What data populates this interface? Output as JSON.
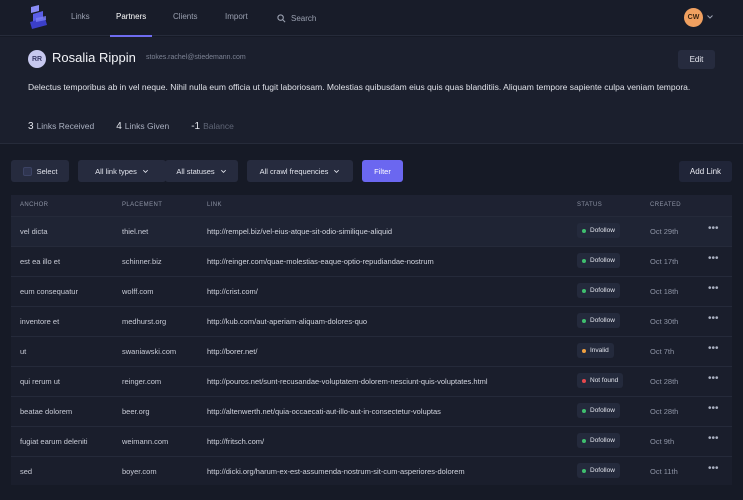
{
  "nav": {
    "items": [
      {
        "label": "Links"
      },
      {
        "label": "Partners"
      },
      {
        "label": "Clients"
      },
      {
        "label": "Import"
      }
    ],
    "search_label": "Search",
    "user_initials": "CW",
    "accent": "#6f6cf0"
  },
  "profile": {
    "initials": "RR",
    "name": "Rosalia Rippin",
    "email": "stokes.rachel@stiedemann.com",
    "edit_label": "Edit",
    "bio": "Delectus temporibus ab in vel neque. Nihil nulla eum officia ut fugit laboriosam. Molestias quibusdam eius quis quas blanditiis. Aliquam tempore sapiente culpa veniam tempora.",
    "stats": [
      {
        "value": "3",
        "label": "Links Received"
      },
      {
        "value": "4",
        "label": "Links Given"
      },
      {
        "value": "-1",
        "label": "Balance"
      }
    ]
  },
  "filters": {
    "select_label": "Select",
    "link_types": "All link types",
    "statuses": "All statuses",
    "crawl": "All crawl frequencies",
    "filter": "Filter",
    "add_link": "Add Link"
  },
  "table": {
    "headers": [
      "ANCHOR",
      "PLACEMENT",
      "LINK",
      "STATUS",
      "CREATED"
    ],
    "rows": [
      {
        "anchor": "vel dicta",
        "placement": "thiel.net",
        "link": "http://rempel.biz/vel-eius-atque-sit-odio-similique-aliquid",
        "status": "Dofollow",
        "status_color": "#3fbf6f",
        "created": "Oct 29th"
      },
      {
        "anchor": "est ea illo et",
        "placement": "schinner.biz",
        "link": "http://reinger.com/quae-molestias-eaque-optio-repudiandae-nostrum",
        "status": "Dofollow",
        "status_color": "#3fbf6f",
        "created": "Oct 17th"
      },
      {
        "anchor": "eum consequatur",
        "placement": "wolff.com",
        "link": "http://crist.com/",
        "status": "Dofollow",
        "status_color": "#3fbf6f",
        "created": "Oct 18th"
      },
      {
        "anchor": "inventore et",
        "placement": "medhurst.org",
        "link": "http://kub.com/aut-aperiam-aliquam-dolores-quo",
        "status": "Dofollow",
        "status_color": "#3fbf6f",
        "created": "Oct 30th"
      },
      {
        "anchor": "ut",
        "placement": "swaniawski.com",
        "link": "http://borer.net/",
        "status": "Invalid",
        "status_color": "#f0a040",
        "created": "Oct 7th"
      },
      {
        "anchor": "qui rerum ut",
        "placement": "reinger.com",
        "link": "http://pouros.net/sunt-recusandae-voluptatem-dolorem-nesciunt-quis-voluptates.html",
        "status": "Not found",
        "status_color": "#e5484d",
        "created": "Oct 28th"
      },
      {
        "anchor": "beatae dolorem",
        "placement": "beer.org",
        "link": "http://altenwerth.net/quia-occaecati-aut-illo-aut-in-consectetur-voluptas",
        "status": "Dofollow",
        "status_color": "#3fbf6f",
        "created": "Oct 28th"
      },
      {
        "anchor": "fugiat earum deleniti",
        "placement": "weimann.com",
        "link": "http://fritsch.com/",
        "status": "Dofollow",
        "status_color": "#3fbf6f",
        "created": "Oct 9th"
      },
      {
        "anchor": "sed",
        "placement": "boyer.com",
        "link": "http://dicki.org/harum-ex-est-assumenda-nostrum-sit-cum-asperiores-dolorem",
        "status": "Dofollow",
        "status_color": "#3fbf6f",
        "created": "Oct 11th"
      }
    ]
  }
}
